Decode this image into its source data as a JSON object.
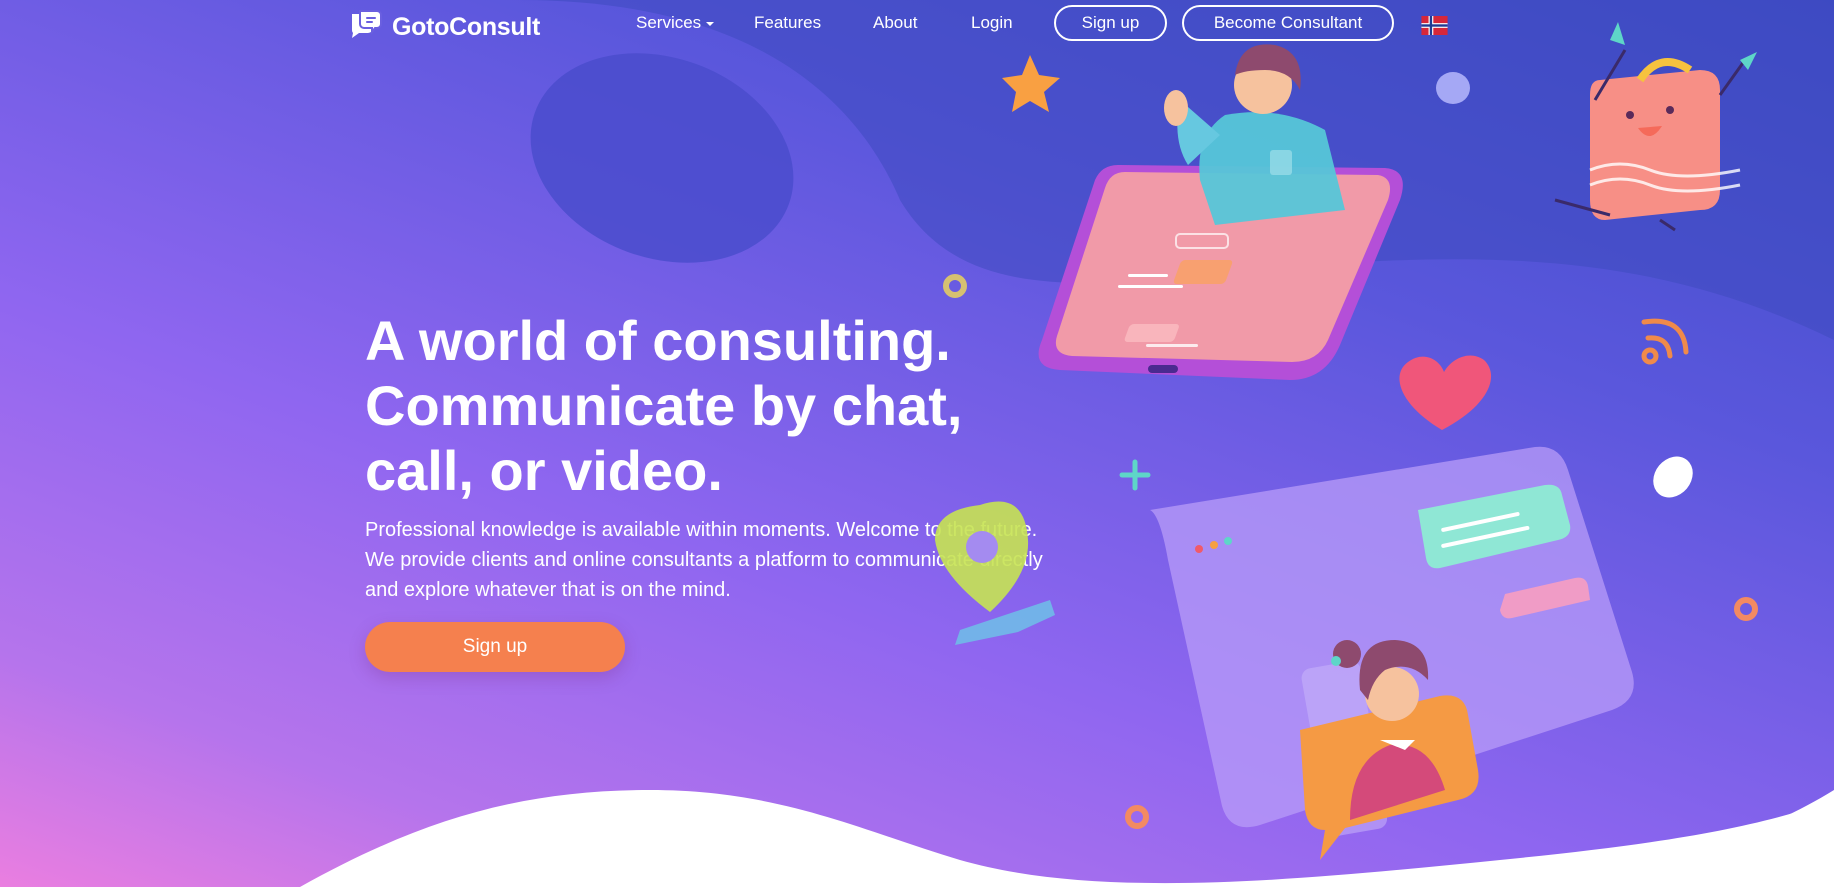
{
  "brand": {
    "name": "GotoConsult"
  },
  "nav": {
    "services_label": "Services",
    "features_label": "Features",
    "about_label": "About",
    "login_label": "Login",
    "signup_label": "Sign up",
    "become_consultant_label": "Become Consultant",
    "language_flag_icon": "norway-flag-icon"
  },
  "hero": {
    "title_lines": [
      "A world of consulting.",
      "Communicate by chat,",
      "call, or video."
    ],
    "description": "Professional knowledge is available within moments. Welcome to the future. We provide clients and online consultants a platform to communicate directly and explore whatever that is on the mind.",
    "cta_label": "Sign up"
  },
  "colors": {
    "accent_orange": "#f5804e",
    "background_start": "#3d4bc6",
    "background_end": "#ea7ee0",
    "text": "#ffffff"
  }
}
